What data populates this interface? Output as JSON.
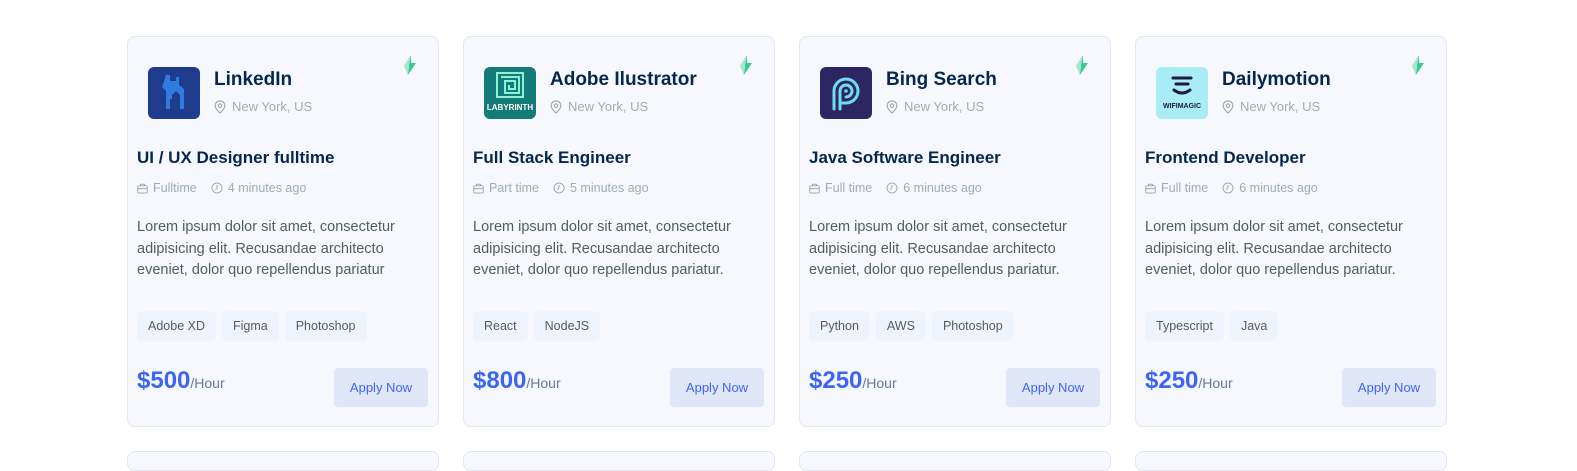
{
  "cards": [
    {
      "company": "LinkedIn",
      "location": "New York, US",
      "logo": {
        "icon": "llama-house-icon",
        "bg": "#1f3c8c",
        "text": ""
      },
      "title": "UI / UX Designer fulltime",
      "job_type": "Fulltime",
      "posted": "4 minutes ago",
      "description": "Lorem ipsum dolor sit amet, consectetur adipisicing elit. Recusandae architecto eveniet, dolor quo repellendus pariatur",
      "tags": [
        "Adobe XD",
        "Figma",
        "Photoshop"
      ],
      "price": "$500",
      "per": "/Hour",
      "apply": "Apply Now"
    },
    {
      "company": "Adobe Ilustrator",
      "location": "New York, US",
      "logo": {
        "icon": "labyrinth-icon",
        "bg": "#137b78",
        "text": "LABYRINTH"
      },
      "title": "Full Stack Engineer",
      "job_type": "Part time",
      "posted": "5 minutes ago",
      "description": "Lorem ipsum dolor sit amet, consectetur adipisicing elit. Recusandae architecto eveniet, dolor quo repellendus pariatur.",
      "tags": [
        "React",
        "NodeJS"
      ],
      "price": "$800",
      "per": "/Hour",
      "apply": "Apply Now"
    },
    {
      "company": "Bing Search",
      "location": "New York, US",
      "logo": {
        "icon": "location-signal-icon",
        "bg": "#2c2662",
        "text": ""
      },
      "title": "Java Software Engineer",
      "job_type": "Full time",
      "posted": "6 minutes ago",
      "description": "Lorem ipsum dolor sit amet, consectetur adipisicing elit. Recusandae architecto eveniet, dolor quo repellendus pariatur.",
      "tags": [
        "Python",
        "AWS",
        "Photoshop"
      ],
      "price": "$250",
      "per": "/Hour",
      "apply": "Apply Now"
    },
    {
      "company": "Dailymotion",
      "location": "New York, US",
      "logo": {
        "icon": "wifi-icon",
        "bg": "#a8ecf5",
        "text": "WIFIMAGIC"
      },
      "title": "Frontend Developer",
      "job_type": "Full time",
      "posted": "6 minutes ago",
      "description": "Lorem ipsum dolor sit amet, consectetur adipisicing elit. Recusandae architecto eveniet, dolor quo repellendus pariatur.",
      "tags": [
        "Typescript",
        "Java"
      ],
      "price": "$250",
      "per": "/Hour",
      "apply": "Apply Now"
    }
  ],
  "colors": {
    "accent": "#3c65f5",
    "flash": "#3ec594",
    "heading": "#05264e"
  }
}
